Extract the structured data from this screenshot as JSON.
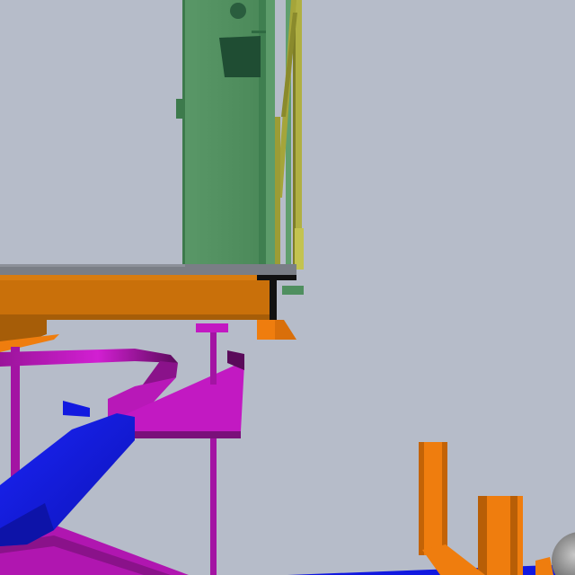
{
  "scene": {
    "background": "#b6bcc9",
    "description_free": true,
    "palette": {
      "cabinet": "#4f8f5f",
      "cabinet_dark": "#1f4d33",
      "cabinet_edge": "#3d7a4c",
      "olive_pipe": "#a9a93a",
      "olive_pipe_dark": "#6f6f1f",
      "beam_orange": "#c9700a",
      "beam_orange_dark": "#8f4d06",
      "beam_black": "#111111",
      "bright_orange": "#ef7d0e",
      "magenta": "#c219c2",
      "magenta_dark": "#7a107a",
      "blue": "#1219e0",
      "blue_dark": "#0a0f8a",
      "grey_slab": "#7a7e86",
      "grey_sphere": "#8a8a8a"
    }
  }
}
